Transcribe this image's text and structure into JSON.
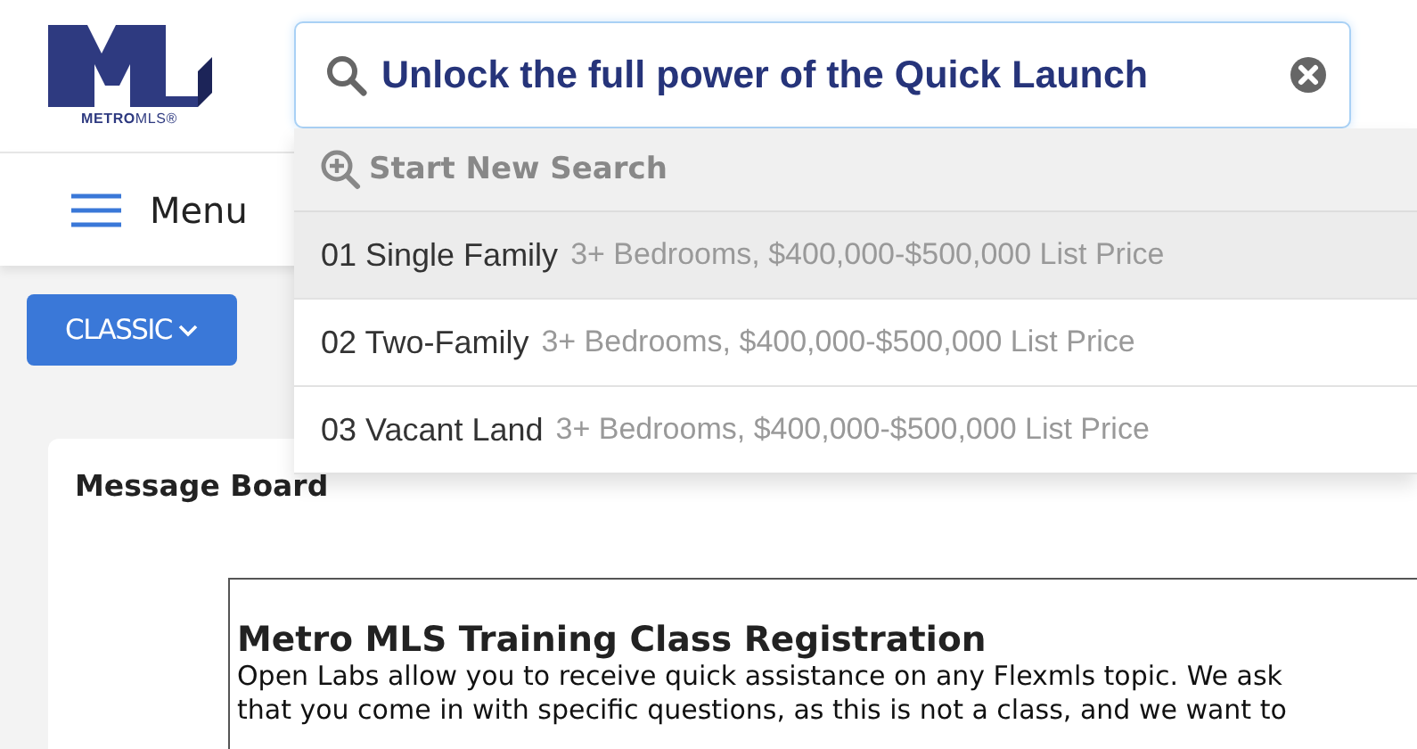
{
  "logo": {
    "wordmark": "**METRO**MLS®"
  },
  "search": {
    "value": "Unlock the full power of the Quick Launch"
  },
  "menu": {
    "label": "Menu"
  },
  "view_button": {
    "label": "CLASSIC"
  },
  "dropdown": {
    "header": "Start New Search",
    "items": [
      {
        "name": "01 Single Family",
        "detail": "3+ Bedrooms, $400,000-$500,000 List Price",
        "selected": true
      },
      {
        "name": "02 Two-Family",
        "detail": "3+ Bedrooms, $400,000-$500,000 List Price",
        "selected": false
      },
      {
        "name": "03 Vacant Land",
        "detail": "3+ Bedrooms, $400,000-$500,000 List Price",
        "selected": false
      }
    ]
  },
  "message_board": {
    "title": "Message Board",
    "post_title": "Metro MLS Training Class Registration",
    "lines": [
      "Open Labs allow you to receive quick assistance on any Flexmls topic. We ask",
      "that you come in with specific questions, as this is not a class, and we want to"
    ]
  }
}
